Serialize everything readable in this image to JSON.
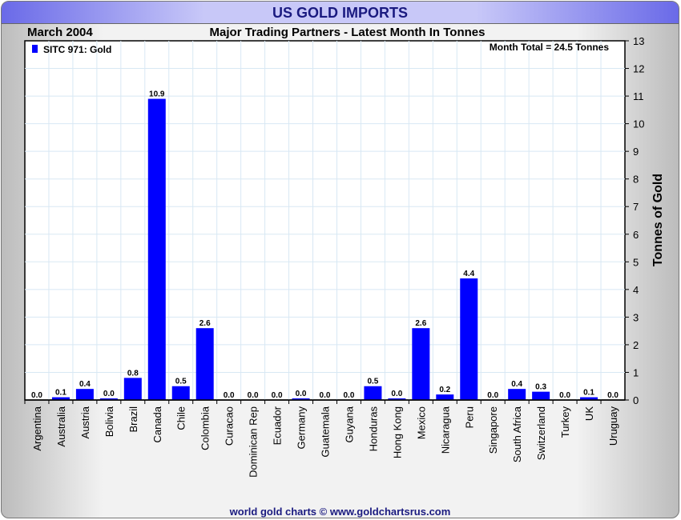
{
  "title": "US GOLD IMPORTS",
  "footer": "world gold charts © www.goldchartsrus.com",
  "chart_data": {
    "type": "bar",
    "title": "Major Trading Partners - Latest Month In Tonnes",
    "period": "March 2004",
    "annotation": "Month Total = 24.5 Tonnes",
    "legend": [
      "SITC 971: Gold"
    ],
    "legend_position": "top-left",
    "xlabel": "",
    "ylabel": "Tonnes of Gold",
    "ylim": [
      0,
      13
    ],
    "yticks": [
      0,
      1,
      2,
      3,
      4,
      5,
      6,
      7,
      8,
      9,
      10,
      11,
      12,
      13
    ],
    "grid": true,
    "bar_color": "#0000ff",
    "categories": [
      "Argentina",
      "Australia",
      "Austria",
      "Bolivia",
      "Brazil",
      "Canada",
      "Chile",
      "Colombia",
      "Curacao",
      "Dominican Rep",
      "Ecuador",
      "Germany",
      "Guatemala",
      "Guyana",
      "Honduras",
      "Hong Kong",
      "Mexico",
      "Nicaragua",
      "Peru",
      "Singapore",
      "South Africa",
      "Switzerland",
      "Turkey",
      "UK",
      "Uruguay"
    ],
    "values": [
      0.0,
      0.1,
      0.4,
      0.04,
      0.8,
      10.9,
      0.5,
      2.6,
      0.0,
      0.0,
      0.0,
      0.04,
      0.0,
      0.0,
      0.5,
      0.04,
      2.6,
      0.2,
      4.4,
      0.0,
      0.4,
      0.3,
      0.0,
      0.1,
      0.0
    ],
    "labels": [
      "0.0",
      "0.1",
      "0.4",
      "0.0",
      "0.8",
      "10.9",
      "0.5",
      "2.6",
      "0.0",
      "0.0",
      "0.0",
      "0.0",
      "0.0",
      "0.0",
      "0.5",
      "0.0",
      "2.6",
      "0.2",
      "4.4",
      "0.0",
      "0.4",
      "0.3",
      "0.0",
      "0.1",
      "0.0"
    ]
  }
}
